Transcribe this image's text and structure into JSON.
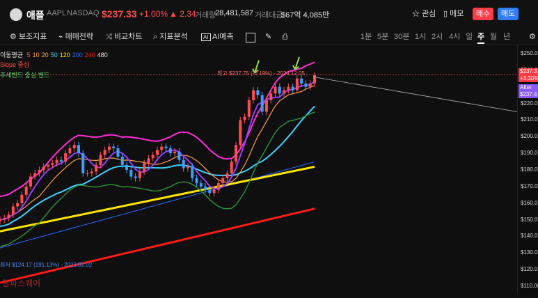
{
  "header": {
    "logo_glyph": "",
    "name": "애플",
    "ticker": "AAPL",
    "exchange": "NASDAQ",
    "price": "$237.33",
    "change_pct": "+1.00%",
    "change_abs": "▲ 2.34",
    "volume_label": "거래량",
    "volume": "28,481,587",
    "amount_label": "거래대금",
    "amount": "$67억 4,085만",
    "watch": "관심",
    "memo": "메모",
    "buy": "매수",
    "sell": "매도",
    "accent_up": "#ff4d4f",
    "accent_down": "#2f7cf6"
  },
  "toolbar": {
    "indicators": "보조지표",
    "strategy": "매매전략",
    "compare": "비교차트",
    "analysis": "지표분석",
    "ai": "AI예측",
    "periods": [
      "1분",
      "5분",
      "30분",
      "1시",
      "2시",
      "4시",
      "일",
      "주",
      "월",
      "년"
    ],
    "active_period": "주"
  },
  "legend": {
    "ma_label": "이동평균",
    "ma_periods": [
      "5",
      "10",
      "20",
      "50",
      "120",
      "200",
      "240",
      "480"
    ],
    "ma_colors": [
      "#ff5c5c",
      "#ff9f43",
      "#ffb347",
      "#3fd0ff",
      "#ffe500",
      "#2c6bff",
      "#ff1a1a",
      "#e8e8e8"
    ],
    "slope_label": "Slope",
    "slope_value": "중심",
    "trend_label": "추세밴드",
    "trend_value": "중심 밴드"
  },
  "annotations": {
    "high": "최고 $237.75 (-0.19%) - 2024.12.05",
    "low": "최저 $124.17 (191.13%) - 2023.01.02",
    "after_label": "After",
    "after_price": "$237.4",
    "price_tag": "$237.3",
    "price_change": "+3.30%"
  },
  "y_axis": [
    "$250.00",
    "$240.00",
    "$230.00",
    "$220.00",
    "$210.00",
    "$200.00",
    "$190.00",
    "$180.00",
    "$170.00",
    "$160.00",
    "$150.00",
    "$140.00",
    "$130.00",
    "$120.00",
    "$110.00"
  ],
  "watermark": "알파스퀘어",
  "chart_data": {
    "type": "candlestick",
    "ylim": [
      110,
      250
    ],
    "interval": "주",
    "closes": [
      150,
      151,
      153,
      158,
      160,
      165,
      170,
      176,
      178,
      180,
      182,
      183,
      184,
      186,
      185,
      190,
      193,
      195,
      190,
      178,
      178,
      179,
      183,
      189,
      192,
      194,
      193,
      188,
      183,
      180,
      176,
      175,
      179,
      184,
      187,
      189,
      192,
      194,
      193,
      190,
      191,
      186,
      181,
      182,
      175,
      172,
      170,
      168,
      166,
      168,
      172,
      175,
      178,
      185,
      195,
      210,
      212,
      222,
      228,
      225,
      215,
      222,
      226,
      230,
      226,
      228,
      230,
      228,
      235,
      232,
      230,
      232,
      237
    ]
  }
}
